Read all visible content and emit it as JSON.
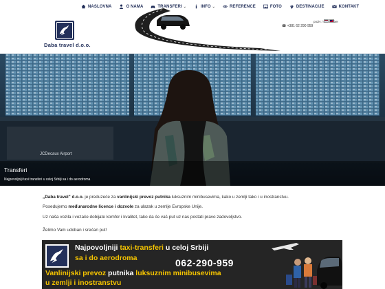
{
  "nav": {
    "items": [
      {
        "label": "NASLOVNA",
        "icon": "home-icon"
      },
      {
        "label": "O NAMA",
        "icon": "user-icon"
      },
      {
        "label": "TRANSFERI",
        "icon": "car-icon"
      },
      {
        "label": "INFO",
        "icon": "info-icon"
      },
      {
        "label": "REFERENCE",
        "icon": "eye-icon"
      },
      {
        "label": "FOTO",
        "icon": "photo-icon"
      },
      {
        "label": "DESTINACIJE",
        "icon": "location-icon"
      },
      {
        "label": "KONTAKT",
        "icon": "mail-icon"
      }
    ]
  },
  "brand": {
    "name": "Daba travel d.o.o."
  },
  "contact": {
    "channels": "poziv / sms / viber",
    "phone": "+381 62 290 959"
  },
  "hero": {
    "title": "Transferi",
    "subtitle": "Najpovoljniji taxi transferi u celoj Srbiji sa i do aerodroma",
    "sign": "JCDecaux Airport"
  },
  "content": {
    "p1_a": "„Daba travel\" d.o.o.",
    "p1_b": " je preduzeće za ",
    "p1_c": "vanlinijski prevoz putnika",
    "p1_d": " luksuznim minibusevima, kako u zemlji tako i u inostranstvu.",
    "p2_a": "Posedujemo ",
    "p2_b": "međunarodne licence i dozvole",
    "p2_c": " za ulazak u zemlje Evropske Unije.",
    "p3": "Uz naša vozila i vozače dobijate komfor i kvalitet, tako da će vaš put uz nas postati pravo zadovoljstvo.",
    "p4": "Želimo Vam udoban i srećan put!"
  },
  "banner": {
    "l1_a": "Najpovoljniji ",
    "l1_b": "taxi-transferi",
    "l1_c": " u celoj Srbiji",
    "l2": "sa i do aerodroma",
    "phone": "062-290-959",
    "l3_a": "Vanlinijski prevoz ",
    "l3_b": "putnika",
    "l3_c": " luksuznim minibusevima",
    "l4": "u zemlji i inostranstvu"
  },
  "colors": {
    "navy": "#23305a",
    "accent_yellow": "#f5c400",
    "banner_bg": "#252525"
  }
}
